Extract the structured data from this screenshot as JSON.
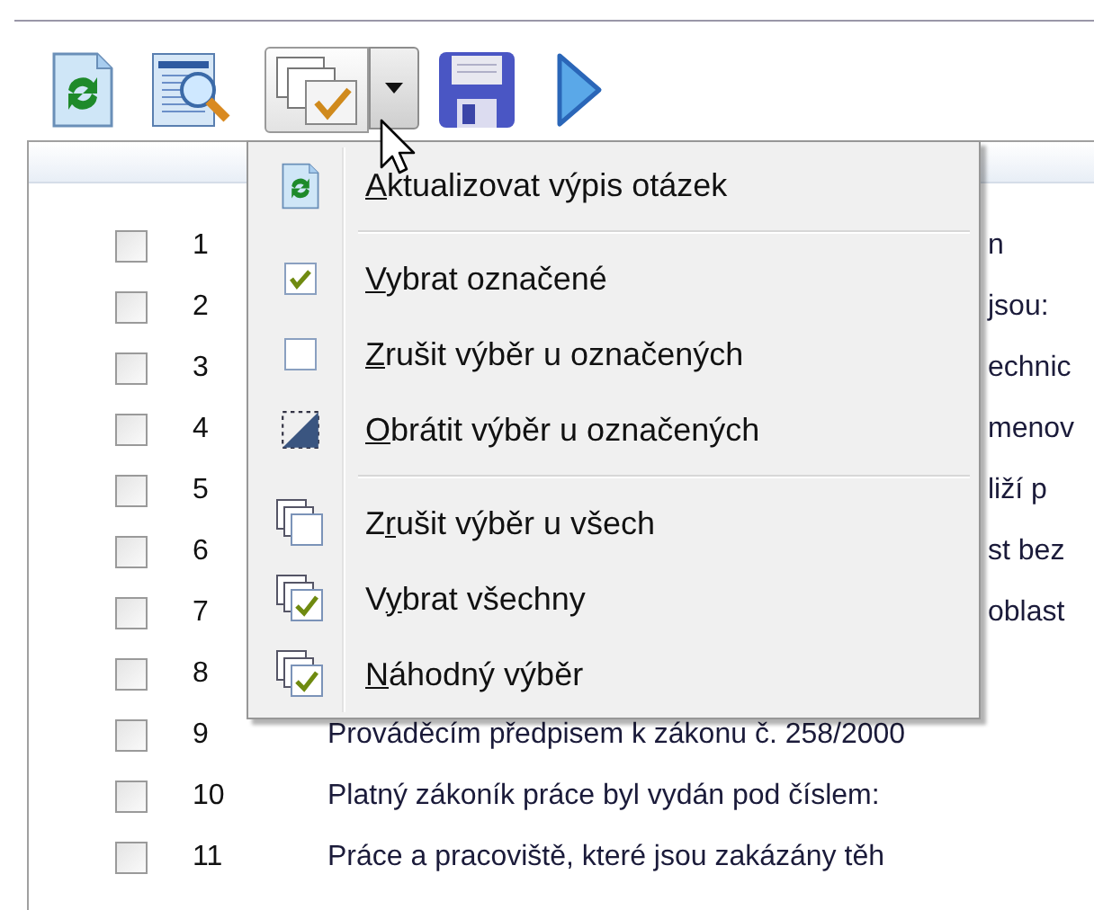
{
  "toolbar": {
    "buttons": [
      {
        "kind": "refresh",
        "pressed": false
      },
      {
        "kind": "preview",
        "pressed": false
      },
      {
        "kind": "select",
        "pressed": true
      },
      {
        "kind": "save",
        "pressed": false
      },
      {
        "kind": "play",
        "pressed": false
      }
    ]
  },
  "questions": {
    "rows": [
      {
        "number": "1",
        "checked": false,
        "kind": "behind_menu",
        "text": "n"
      },
      {
        "number": "2",
        "checked": false,
        "kind": "behind_menu",
        "text": "jsou:"
      },
      {
        "number": "3",
        "checked": false,
        "kind": "behind_menu",
        "text": "echnic"
      },
      {
        "number": "4",
        "checked": false,
        "kind": "behind_menu",
        "text": "menov"
      },
      {
        "number": "5",
        "checked": false,
        "kind": "behind_menu",
        "text": "liží p"
      },
      {
        "number": "6",
        "checked": false,
        "kind": "behind_menu",
        "text": "st bez"
      },
      {
        "number": "7",
        "checked": false,
        "kind": "behind_menu",
        "text": "oblast"
      },
      {
        "number": "8",
        "checked": false
      },
      {
        "number": "9",
        "checked": false,
        "kind": "full",
        "text": "Prováděcím předpisem k zákonu č. 258/2000"
      },
      {
        "number": "10",
        "checked": false,
        "kind": "full",
        "text": "Platný zákoník práce byl vydán pod číslem:"
      },
      {
        "number": "11",
        "checked": false,
        "kind": "full",
        "text": "Práce a pracoviště, které jsou zakázány těh"
      }
    ]
  },
  "menu": {
    "items": [
      {
        "kind": "refresh",
        "access_key": "A",
        "label_rest": "ktualizovat výpis otázek"
      },
      {
        "kind": "separator"
      },
      {
        "kind": "check",
        "access_key": "V",
        "label_rest": "ybrat označené"
      },
      {
        "kind": "uncheck",
        "access_key": "Z",
        "label_rest": "rušit výběr u označených"
      },
      {
        "kind": "invert",
        "access_key": "O",
        "label_rest": "brátit výběr u označených"
      },
      {
        "kind": "separator"
      },
      {
        "kind": "stack",
        "label_start": "Z",
        "access_key": "r",
        "label_rest": "ušit výběr u všech"
      },
      {
        "kind": "stack_check",
        "label_start": "V",
        "access_key": "y",
        "label_rest": "brat všechny"
      },
      {
        "kind": "stack_check",
        "access_key": "N",
        "label_rest": "áhodný výběr"
      }
    ]
  }
}
